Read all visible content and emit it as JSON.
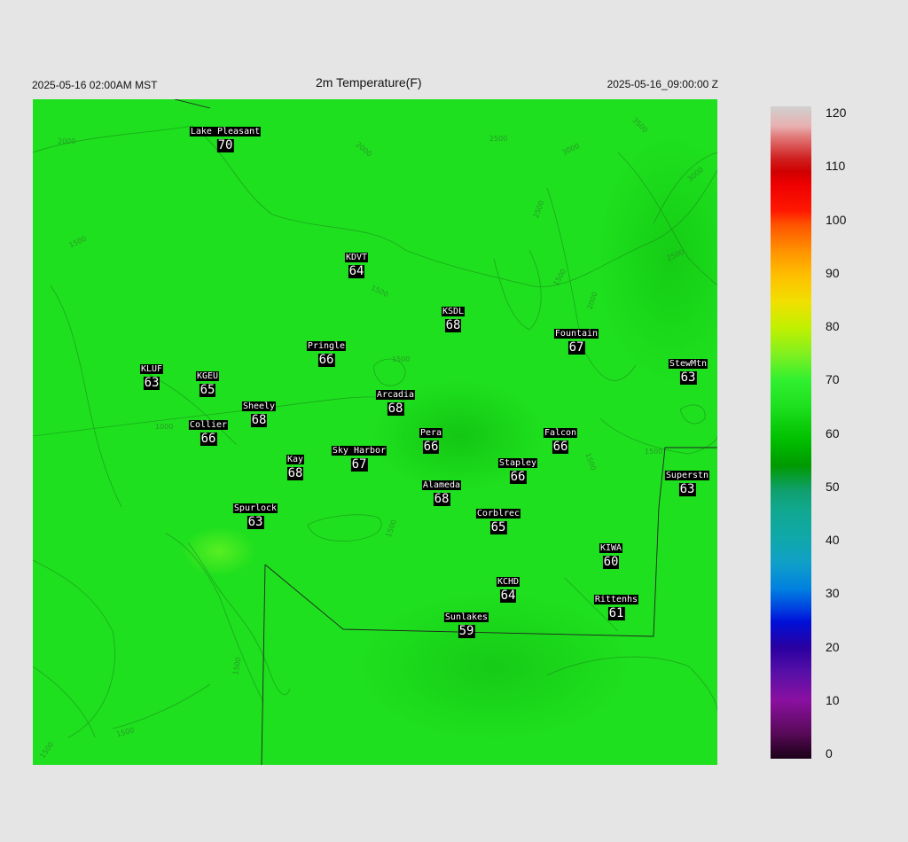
{
  "header": {
    "local_time": "2025-05-16 02:00AM MST",
    "title": "2m Temperature(F)",
    "utc_time": "2025-05-16_09:00:00 Z"
  },
  "stations": [
    {
      "name": "Lake Pleasant",
      "value": "70"
    },
    {
      "name": "KDVT",
      "value": "64"
    },
    {
      "name": "KSDL",
      "value": "68"
    },
    {
      "name": "Fountain",
      "value": "67"
    },
    {
      "name": "Pringle",
      "value": "66"
    },
    {
      "name": "StewMtn",
      "value": "63"
    },
    {
      "name": "KLUF",
      "value": "63"
    },
    {
      "name": "KGEU",
      "value": "65"
    },
    {
      "name": "Arcadia",
      "value": "68"
    },
    {
      "name": "Sheely",
      "value": "68"
    },
    {
      "name": "Collier",
      "value": "66"
    },
    {
      "name": "Pera",
      "value": "66"
    },
    {
      "name": "Falcon",
      "value": "66"
    },
    {
      "name": "Sky Harbor",
      "value": "67"
    },
    {
      "name": "Kay",
      "value": "68"
    },
    {
      "name": "Stapley",
      "value": "66"
    },
    {
      "name": "Superstn",
      "value": "63"
    },
    {
      "name": "Alameda",
      "value": "68"
    },
    {
      "name": "Spurlock",
      "value": "63"
    },
    {
      "name": "Corblrec",
      "value": "65"
    },
    {
      "name": "KIWA",
      "value": "60"
    },
    {
      "name": "KCHD",
      "value": "64"
    },
    {
      "name": "Rittenhs",
      "value": "61"
    },
    {
      "name": "Sunlakes",
      "value": "59"
    }
  ],
  "contour_labels": [
    "2000",
    "2000",
    "2500",
    "3000",
    "3500",
    "2500",
    "3000",
    "2500",
    "1500",
    "1500",
    "1500",
    "2000",
    "1500",
    "1500",
    "1500",
    "1000",
    "1500",
    "1500",
    "1500",
    "1500"
  ],
  "colorbar": {
    "ticks": [
      "120",
      "110",
      "100",
      "90",
      "80",
      "70",
      "60",
      "50",
      "40",
      "30",
      "20",
      "10",
      "0"
    ],
    "min": 0,
    "max": 120
  }
}
